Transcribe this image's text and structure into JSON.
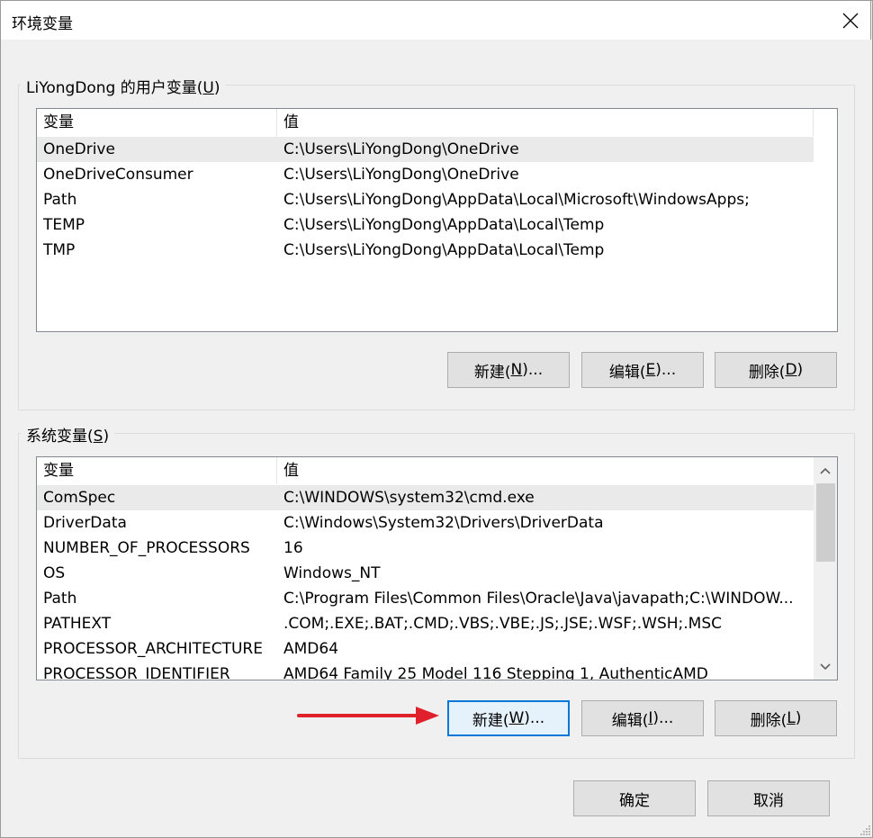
{
  "window": {
    "title": "环境变量",
    "close_icon": "close-icon"
  },
  "user_vars": {
    "group_label": "LiYongDong 的用户变量(",
    "group_key": "U",
    "group_close": ")",
    "col_var": "变量",
    "col_val": "值",
    "rows": [
      {
        "name": "OneDrive",
        "value": "C:\\Users\\LiYongDong\\OneDrive"
      },
      {
        "name": "OneDriveConsumer",
        "value": "C:\\Users\\LiYongDong\\OneDrive"
      },
      {
        "name": "Path",
        "value": "C:\\Users\\LiYongDong\\AppData\\Local\\Microsoft\\WindowsApps;"
      },
      {
        "name": "TEMP",
        "value": "C:\\Users\\LiYongDong\\AppData\\Local\\Temp"
      },
      {
        "name": "TMP",
        "value": "C:\\Users\\LiYongDong\\AppData\\Local\\Temp"
      }
    ],
    "buttons": {
      "new": {
        "pre": "新建(",
        "key": "N",
        "post": ")..."
      },
      "edit": {
        "pre": "编辑(",
        "key": "E",
        "post": ")..."
      },
      "delete": {
        "pre": "删除(",
        "key": "D",
        "post": ")"
      }
    }
  },
  "system_vars": {
    "group_label": "系统变量(",
    "group_key": "S",
    "group_close": ")",
    "col_var": "变量",
    "col_val": "值",
    "rows": [
      {
        "name": "ComSpec",
        "value": "C:\\WINDOWS\\system32\\cmd.exe"
      },
      {
        "name": "DriverData",
        "value": "C:\\Windows\\System32\\Drivers\\DriverData"
      },
      {
        "name": "NUMBER_OF_PROCESSORS",
        "value": "16"
      },
      {
        "name": "OS",
        "value": "Windows_NT"
      },
      {
        "name": "Path",
        "value": "C:\\Program Files\\Common Files\\Oracle\\Java\\javapath;C:\\WINDOW..."
      },
      {
        "name": "PATHEXT",
        "value": ".COM;.EXE;.BAT;.CMD;.VBS;.VBE;.JS;.JSE;.WSF;.WSH;.MSC"
      },
      {
        "name": "PROCESSOR_ARCHITECTURE",
        "value": "AMD64"
      },
      {
        "name": "PROCESSOR_IDENTIFIER",
        "value": "AMD64 Family 25 Model 116 Stepping 1, AuthenticAMD"
      }
    ],
    "buttons": {
      "new": {
        "pre": "新建(",
        "key": "W",
        "post": ")..."
      },
      "edit": {
        "pre": "编辑(",
        "key": "I",
        "post": ")..."
      },
      "delete": {
        "pre": "删除(",
        "key": "L",
        "post": ")"
      }
    }
  },
  "footer": {
    "ok": "确定",
    "cancel": "取消"
  },
  "colors": {
    "annotation_arrow": "#e0202a",
    "focus_border": "#0078d7"
  }
}
